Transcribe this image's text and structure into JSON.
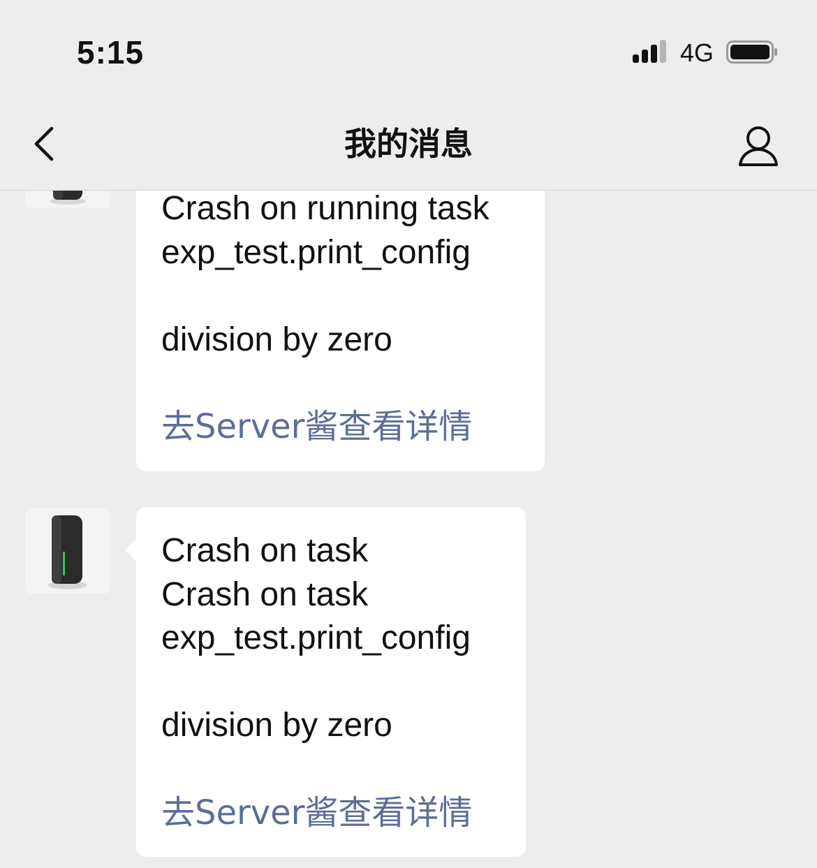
{
  "status_bar": {
    "time": "5:15",
    "network": "4G",
    "signal_icon": "cellular-signal-icon",
    "battery_icon": "battery-icon"
  },
  "nav": {
    "title": "我的消息",
    "back_icon": "chevron-left-icon",
    "profile_icon": "user-icon"
  },
  "messages": [
    {
      "lines": [
        "Crash on running task",
        "exp_test.print_config",
        "",
        "division by zero"
      ],
      "link": "去Server酱查看详情"
    },
    {
      "lines": [
        "Crash on task",
        "Crash on task",
        "exp_test.print_config",
        "",
        "division by zero"
      ],
      "link": "去Server酱查看详情"
    }
  ],
  "colors": {
    "background": "#ededed",
    "bubble": "#ffffff",
    "link": "#5b6e95",
    "device_accent": "#39c44a"
  }
}
